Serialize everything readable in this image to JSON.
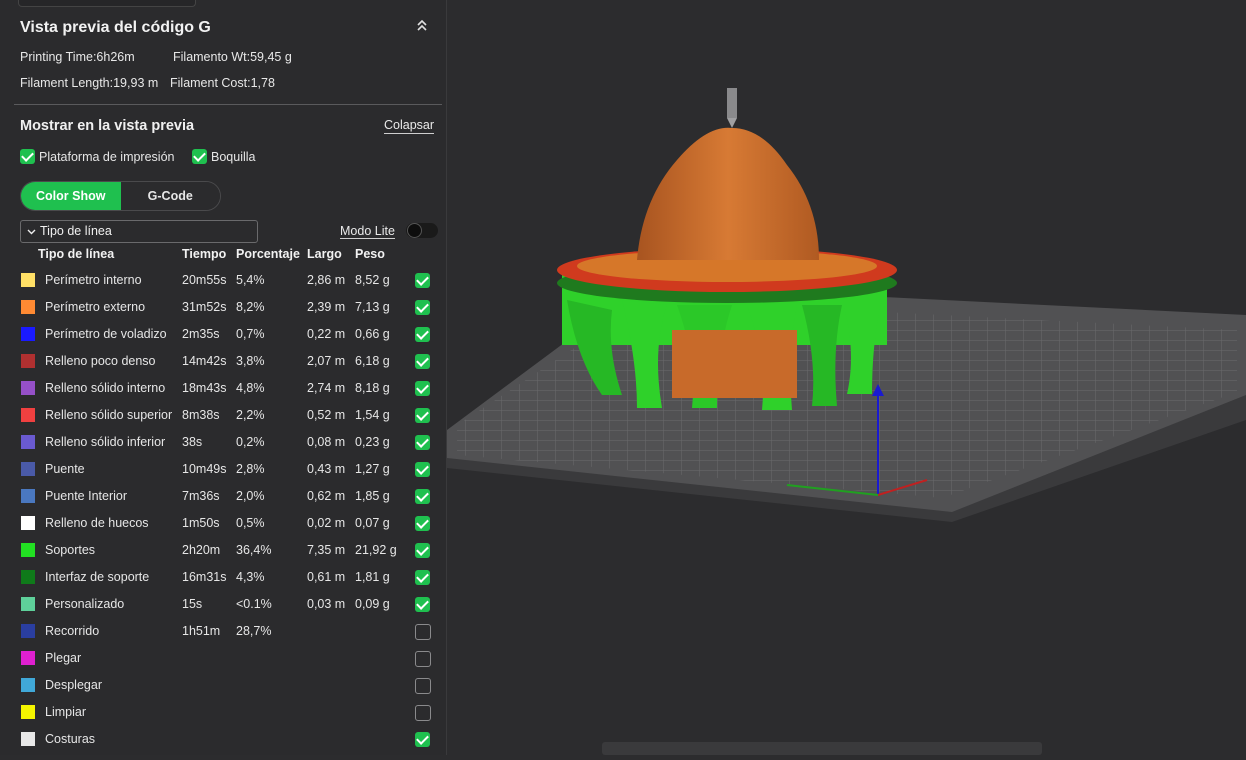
{
  "panel": {
    "title": "Vista previa del código G",
    "collapse_icon": "double-chevron-up-icon",
    "stats": {
      "printing_time": "Printing Time:6h26m",
      "filament_wt": "Filamento Wt:59,45 g",
      "filament_length": "Filament Length:19,93 m",
      "filament_cost": "Filament Cost:1,78"
    },
    "show_section": {
      "title": "Mostrar en la vista previa",
      "collapse_link": "Colapsar",
      "options": [
        {
          "label": "Plataforma de impresión",
          "checked": true
        },
        {
          "label": "Boquilla",
          "checked": true
        }
      ]
    },
    "mode_tabs": {
      "active": "Color Show",
      "inactive": "G-Code"
    },
    "line_type_dropdown": "Tipo de línea",
    "lite_mode": {
      "label": "Modo Lite",
      "on": false
    },
    "table": {
      "headers": [
        "Tipo de línea",
        "Tiempo",
        "Porcentaje",
        "Largo",
        "Peso"
      ],
      "rows": [
        {
          "color": "#ffe066",
          "name": "Perímetro interno",
          "time": "20m55s",
          "pct": "5,4%",
          "len": "2,86 m",
          "wt": "8,52 g",
          "checked": true
        },
        {
          "color": "#ff8a33",
          "name": "Perímetro externo",
          "time": "31m52s",
          "pct": "8,2%",
          "len": "2,39 m",
          "wt": "7,13 g",
          "checked": true
        },
        {
          "color": "#1a1aff",
          "name": "Perímetro de voladizo",
          "time": "2m35s",
          "pct": "0,7%",
          "len": "0,22 m",
          "wt": "0,66 g",
          "checked": true
        },
        {
          "color": "#b03030",
          "name": "Relleno poco denso",
          "time": "14m42s",
          "pct": "3,8%",
          "len": "2,07 m",
          "wt": "6,18 g",
          "checked": true
        },
        {
          "color": "#9550c8",
          "name": "Relleno sólido interno",
          "time": "18m43s",
          "pct": "4,8%",
          "len": "2,74 m",
          "wt": "8,18 g",
          "checked": true
        },
        {
          "color": "#f04040",
          "name": "Relleno sólido superior",
          "time": "8m38s",
          "pct": "2,2%",
          "len": "0,52 m",
          "wt": "1,54 g",
          "checked": true
        },
        {
          "color": "#6a5ad0",
          "name": "Relleno sólido inferior",
          "time": "38s",
          "pct": "0,2%",
          "len": "0,08 m",
          "wt": "0,23 g",
          "checked": true
        },
        {
          "color": "#4a5aa8",
          "name": "Puente",
          "time": "10m49s",
          "pct": "2,8%",
          "len": "0,43 m",
          "wt": "1,27 g",
          "checked": true
        },
        {
          "color": "#4a78c0",
          "name": "Puente Interior",
          "time": "7m36s",
          "pct": "2,0%",
          "len": "0,62 m",
          "wt": "1,85 g",
          "checked": true
        },
        {
          "color": "#ffffff",
          "name": "Relleno de huecos",
          "time": "1m50s",
          "pct": "0,5%",
          "len": "0,02 m",
          "wt": "0,07 g",
          "checked": true
        },
        {
          "color": "#22e022",
          "name": "Soportes",
          "time": "2h20m",
          "pct": "36,4%",
          "len": "7,35 m",
          "wt": "21,92 g",
          "checked": true
        },
        {
          "color": "#0f7a1a",
          "name": "Interfaz de soporte",
          "time": "16m31s",
          "pct": "4,3%",
          "len": "0,61 m",
          "wt": "1,81 g",
          "checked": true
        },
        {
          "color": "#5ed09a",
          "name": "Personalizado",
          "time": "15s",
          "pct": "<0.1%",
          "len": "0,03 m",
          "wt": "0,09 g",
          "checked": true
        },
        {
          "color": "#2a3ea0",
          "name": "Recorrido",
          "time": "1h51m",
          "pct": "28,7%",
          "len": "",
          "wt": "",
          "checked": false
        },
        {
          "color": "#e020d0",
          "name": "Plegar",
          "time": "",
          "pct": "",
          "len": "",
          "wt": "",
          "checked": false
        },
        {
          "color": "#40a8d8",
          "name": "Desplegar",
          "time": "",
          "pct": "",
          "len": "",
          "wt": "",
          "checked": false
        },
        {
          "color": "#f5f500",
          "name": "Limpiar",
          "time": "",
          "pct": "",
          "len": "",
          "wt": "",
          "checked": false
        },
        {
          "color": "#e8e8e8",
          "name": "Costuras",
          "time": "",
          "pct": "",
          "len": "",
          "wt": "",
          "checked": true
        }
      ]
    }
  },
  "viewport": {
    "support_color": "#2fd12a",
    "model_color": "#c86a2a",
    "brim_color": "#d03a1e",
    "axis_colors": {
      "x": "#c02020",
      "y": "#20a020",
      "z": "#1a1ad0"
    }
  }
}
